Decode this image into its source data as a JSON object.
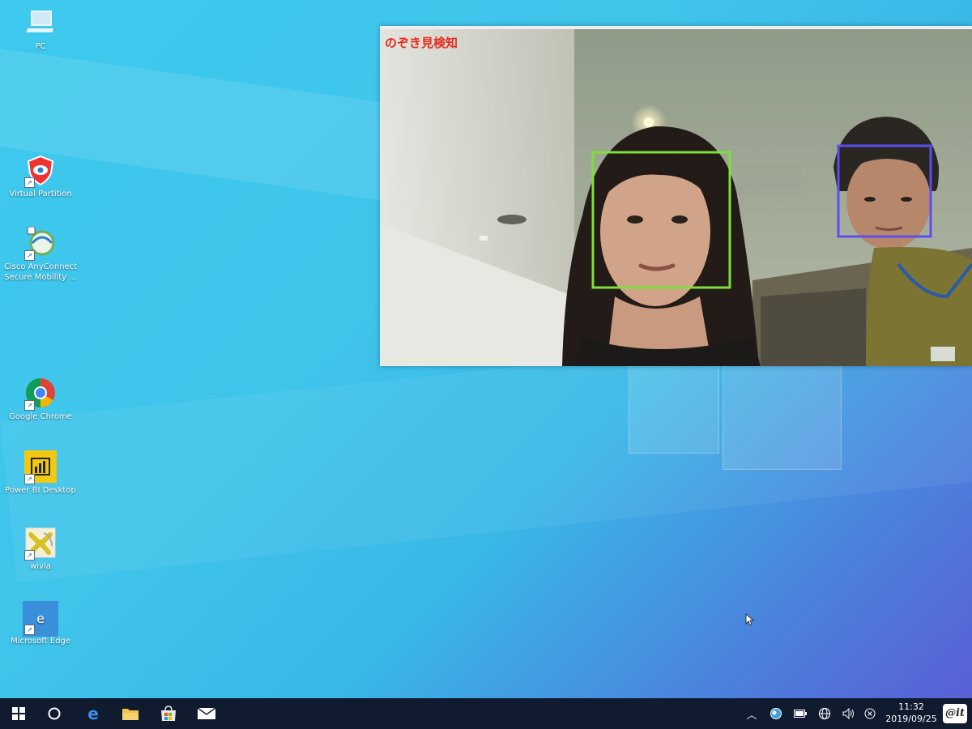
{
  "desktop": {
    "icons": [
      {
        "label": "PC",
        "icon": "computer-icon"
      },
      {
        "label": "Virtual Partition",
        "icon": "shield-icon"
      },
      {
        "label": "Cisco AnyConnect Secure Mobility ...",
        "icon": "globe-icon"
      },
      {
        "label": "Google Chrome",
        "icon": "chrome-icon"
      },
      {
        "label": "Power BI Desktop",
        "icon": "powerbi-icon"
      },
      {
        "label": "wivia",
        "icon": "wivia-icon"
      },
      {
        "label": "Microsoft Edge",
        "icon": "edge-icon"
      }
    ]
  },
  "camera_window": {
    "title": "のぞき見検知",
    "detections": [
      {
        "color": "#7ee03a",
        "label": "face-primary"
      },
      {
        "color": "#5a4ff0",
        "label": "face-peeker"
      }
    ]
  },
  "taskbar": {
    "items": [
      "start-icon",
      "cortana-icon",
      "edge-icon",
      "file-explorer-icon",
      "store-icon",
      "mail-icon"
    ],
    "tray": [
      "chevron-up-icon",
      "onedrive-icon",
      "battery-icon",
      "network-icon",
      "volume-icon",
      "notification-close-icon"
    ],
    "clock_time": "11:32",
    "clock_date": "2019/09/25",
    "watermark": "@it"
  },
  "colors": {
    "title_red": "#e82a1b",
    "taskbar_bg": "#101b30"
  }
}
